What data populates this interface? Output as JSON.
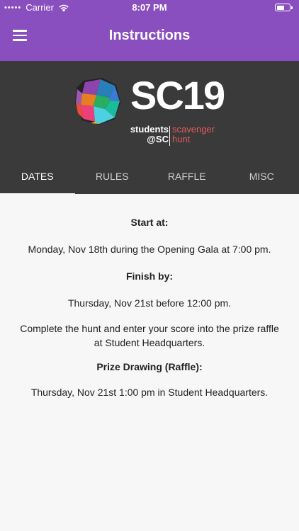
{
  "status_bar": {
    "signal": "•••••",
    "carrier": "Carrier",
    "time": "8:07 PM"
  },
  "header": {
    "title": "Instructions",
    "menu_icon": "hamburger-menu-icon"
  },
  "banner": {
    "logo_title": "SC19",
    "logo_left_line1": "students",
    "logo_left_line2": "@SC",
    "logo_right_line1": "scavenger",
    "logo_right_line2": "hunt",
    "accent_color": "#e55a5a"
  },
  "tabs": [
    {
      "label": "DATES",
      "active": true
    },
    {
      "label": "RULES",
      "active": false
    },
    {
      "label": "RAFFLE",
      "active": false
    },
    {
      "label": "MISC",
      "active": false
    }
  ],
  "content": {
    "start_heading": "Start at:",
    "start_text": "Monday, Nov 18th during the Opening Gala at 7:00 pm.",
    "finish_heading": "Finish by:",
    "finish_text": "Thursday, Nov 21st before 12:00 pm.",
    "complete_text": "Complete the hunt and enter your score into the prize raffle at Student Headquarters.",
    "prize_heading": "Prize Drawing (Raffle):",
    "prize_text": "Thursday, Nov 21st 1:00 pm in Student Headquarters."
  },
  "colors": {
    "primary": "#8a4fbf",
    "banner_bg": "#3a3a3a",
    "content_bg": "#f7f7f7"
  }
}
